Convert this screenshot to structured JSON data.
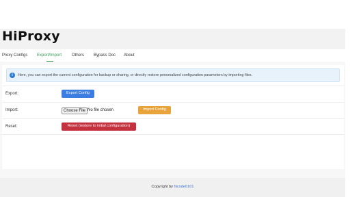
{
  "app": {
    "title": "HiProxy"
  },
  "nav": {
    "tabs": [
      {
        "label": "Proxy Configs"
      },
      {
        "label": "Export/Import"
      },
      {
        "label": "Others"
      },
      {
        "label": "Bypass Doc"
      },
      {
        "label": "About"
      }
    ],
    "active_index": 1
  },
  "alert": {
    "icon": "info-icon",
    "text": "Here, you can export the current configuration for backup or sharing, or directly restore personalized configuration parameters by importing files."
  },
  "export": {
    "label": "Export:",
    "button": "Export Config"
  },
  "import": {
    "label": "Import:",
    "file_button": "Choose File",
    "file_status": "No file chosen",
    "button": "Import Config"
  },
  "reset": {
    "label": "Reset:",
    "button": "Reset (restore to initial configuration)"
  },
  "footer": {
    "prefix": "Copyright by",
    "author": "hicode0101"
  },
  "colors": {
    "accent": "#3b9a5a",
    "export": "#3b7de0",
    "import": "#e8a33a",
    "reset": "#c4313f",
    "link": "#3b6fd6"
  }
}
